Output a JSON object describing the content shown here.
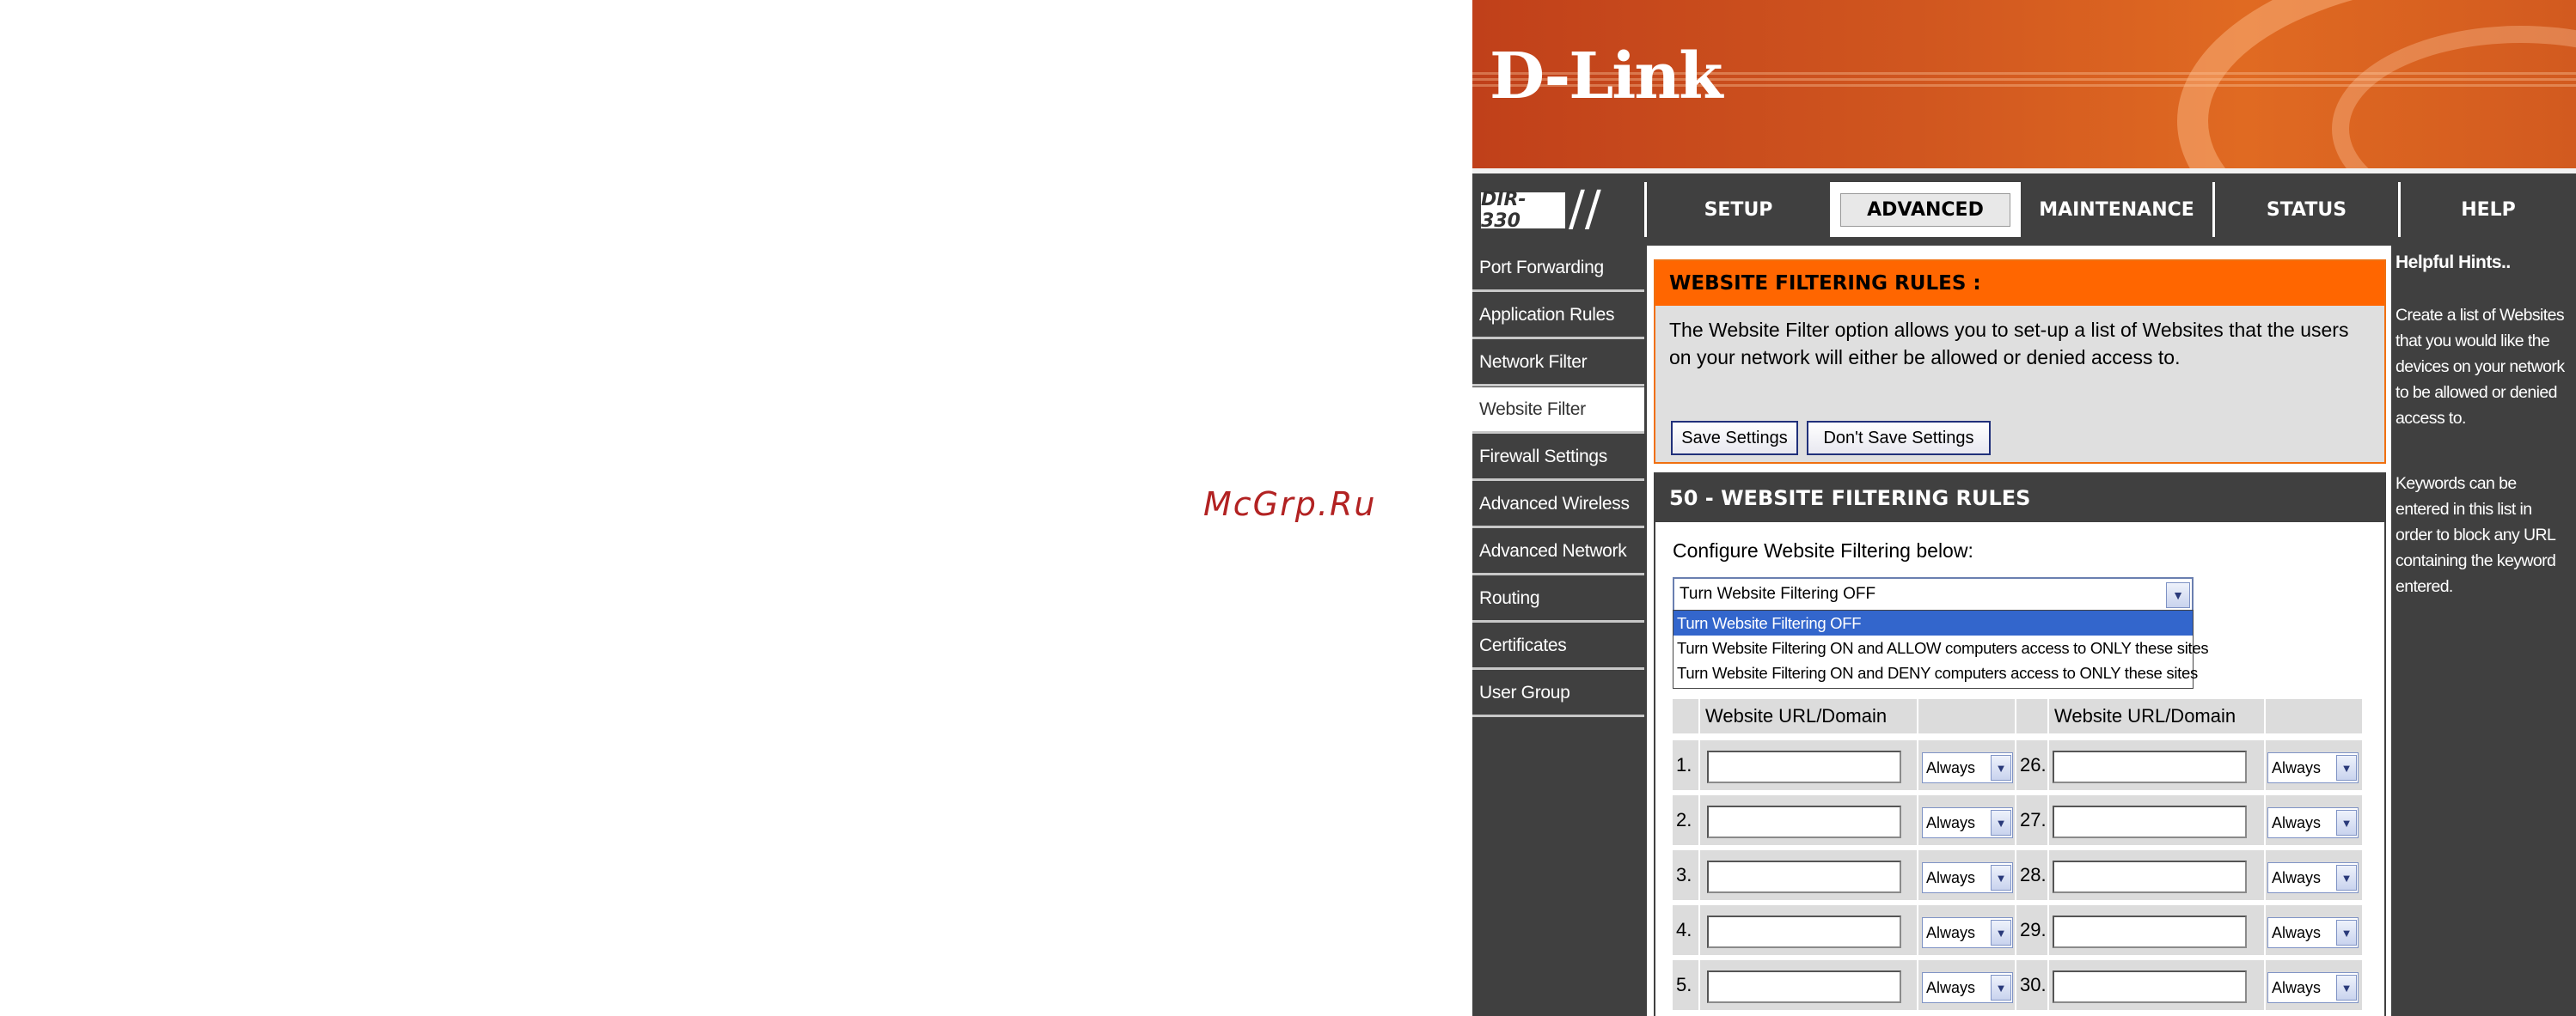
{
  "watermark": "McGrp.Ru",
  "brand": {
    "logo": "D-Link",
    "model": "DIR-330",
    "slash": "//"
  },
  "tabs": [
    {
      "label": "SETUP",
      "active": false
    },
    {
      "label": "ADVANCED",
      "active": true
    },
    {
      "label": "MAINTENANCE",
      "active": false
    },
    {
      "label": "STATUS",
      "active": false
    },
    {
      "label": "HELP",
      "active": false
    }
  ],
  "sidebar": {
    "items": [
      {
        "label": "Port Forwarding"
      },
      {
        "label": "Application Rules"
      },
      {
        "label": "Network Filter"
      },
      {
        "label": "Website Filter",
        "active": true
      },
      {
        "label": "Firewall Settings"
      },
      {
        "label": "Advanced Wireless"
      },
      {
        "label": "Advanced Network"
      },
      {
        "label": "Routing"
      },
      {
        "label": "Certificates"
      },
      {
        "label": "User Group"
      }
    ]
  },
  "intro": {
    "title": "WEBSITE FILTERING RULES :",
    "text": "The Website Filter option allows you to set-up a list of Websites that the users on your network will either be allowed or denied access to.",
    "save_label": "Save Settings",
    "dont_save_label": "Don't Save Settings"
  },
  "rules_section": {
    "title": "50 - WEBSITE FILTERING RULES",
    "config_label": "Configure Website Filtering below:",
    "select_value": "Turn Website Filtering OFF",
    "options": [
      "Turn Website Filtering OFF",
      "Turn Website Filtering ON and ALLOW computers access to ONLY these sites",
      "Turn Website Filtering ON and DENY computers access to ONLY these sites"
    ],
    "col_header_left": "Website URL/Domain",
    "col_header_right": "Website URL/Domain",
    "schedule_default": "Always",
    "rows_left": [
      "1.",
      "2.",
      "3.",
      "4.",
      "5."
    ],
    "rows_right": [
      "26.",
      "27.",
      "28.",
      "29.",
      "30."
    ]
  },
  "hints": {
    "title": "Helpful Hints..",
    "p1": "Create a list of Websites that you would like the devices on your network to be allowed or denied access to.",
    "p2": "Keywords can be entered in this list in order to block any URL containing the keyword entered."
  },
  "colors": {
    "header_orange": "#d0561f",
    "section_orange": "#ff6600",
    "dark_gray": "#404040",
    "select_blue": "#3366cc"
  }
}
